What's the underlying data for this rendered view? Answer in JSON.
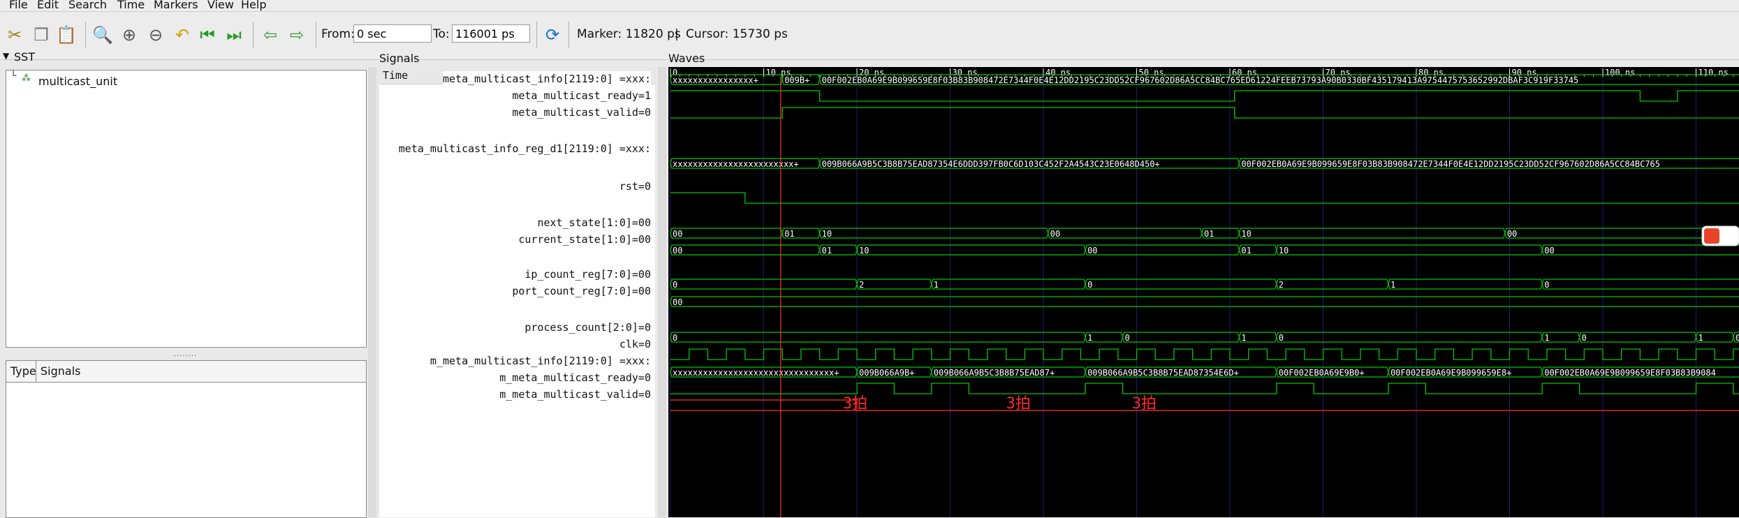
{
  "menu": [
    "File",
    "Edit",
    "Search",
    "Time",
    "Markers",
    "View",
    "Help"
  ],
  "toolbar": {
    "from_label": "From:",
    "from_value": "0 sec",
    "to_label": "To:",
    "to_value": "116001 ps",
    "marker": "Marker: 11820 ps",
    "separator": "|",
    "cursor": "Cursor: 15730 ps"
  },
  "sst": {
    "title": "SST",
    "tree_item": "multicast_unit",
    "splitter": "........",
    "col_type": "Type",
    "col_signals": "Signals"
  },
  "signals_panel": {
    "title": "Signals",
    "time_header": "Time",
    "rows": [
      "meta_multicast_info[2119:0] =xxx:",
      "meta_multicast_ready=1",
      "meta_multicast_valid=0",
      "",
      "meta_multicast_info_reg_d1[2119:0] =xxx:",
      "",
      "rst=0",
      "",
      "next_state[1:0]=00",
      "current_state[1:0]=00",
      "",
      "ip_count_reg[7:0]=00",
      "port_count_reg[7:0]=00",
      "",
      "process_count[2:0]=0",
      "clk=0",
      "m_meta_multicast_info[2119:0] =xxx:",
      "m_meta_multicast_ready=0",
      "m_meta_multicast_valid=0"
    ]
  },
  "waves_panel": {
    "title": "Waves",
    "ticks": [
      "0",
      "10 ns",
      "20 ns",
      "30 ns",
      "40 ns",
      "50 ns",
      "60 ns",
      "70 ns",
      "80 ns",
      "90 ns",
      "100 ns",
      "110 ns"
    ],
    "annotations": [
      "3拍",
      "3拍",
      "3拍"
    ],
    "bus_labels": {
      "meta_info": [
        "xxxxxxxxxxxxxxxx+",
        "009B+",
        "00F002EB0A69E9B099659E8F03B83B908472E7344F0E4E12DD2195C23DD52CF967602D86A5CC84BC765ED61224FEEB73793A90B0330BF435179413A9754475753652992DBAF3C919F33745"
      ],
      "info_reg_d1": [
        "xxxxxxxxxxxxxxxxxxxxxxxx+",
        "009B066A9B5C3B8B75EAD87354E6DDD397FB0C6D103C452F2A4543C23E0648D450+",
        "00F002EB0A69E9B099659E8F03B83B908472E7344F0E4E12DD2195C23DD52CF967602D86A5CC84BC765"
      ],
      "next_state": [
        "00",
        "01",
        "10",
        "00",
        "01",
        "10",
        "00"
      ],
      "current_state": [
        "00",
        "01",
        "10",
        "00",
        "01",
        "10",
        "00"
      ],
      "ip_count": [
        "0",
        "2",
        "1",
        "0",
        "2",
        "1",
        "0"
      ],
      "port_count": [
        "00"
      ],
      "process_count": [
        "0",
        "1",
        "0",
        "1",
        "0",
        "1",
        "0",
        "1",
        "0"
      ],
      "m_info": [
        "xxxxxxxxxxxxxxxxxxxxxxxxxxxxxxxx+",
        "009B066A9B+",
        "009B066A9B5C3B8B75EAD87+",
        "009B066A9B5C3B8B75EAD87354E6D+",
        "00F002EB0A69E9B0+",
        "00F002EB0A69E9B099659E8+",
        "00F002EB0A69E9B099659E8F03B83B9084"
      ]
    }
  },
  "colors": {
    "wave": "#00c800",
    "grid": "#1e1e6e",
    "marker": "#ff3333",
    "text": "#ffffff",
    "annotation": "#ff2a2a"
  }
}
